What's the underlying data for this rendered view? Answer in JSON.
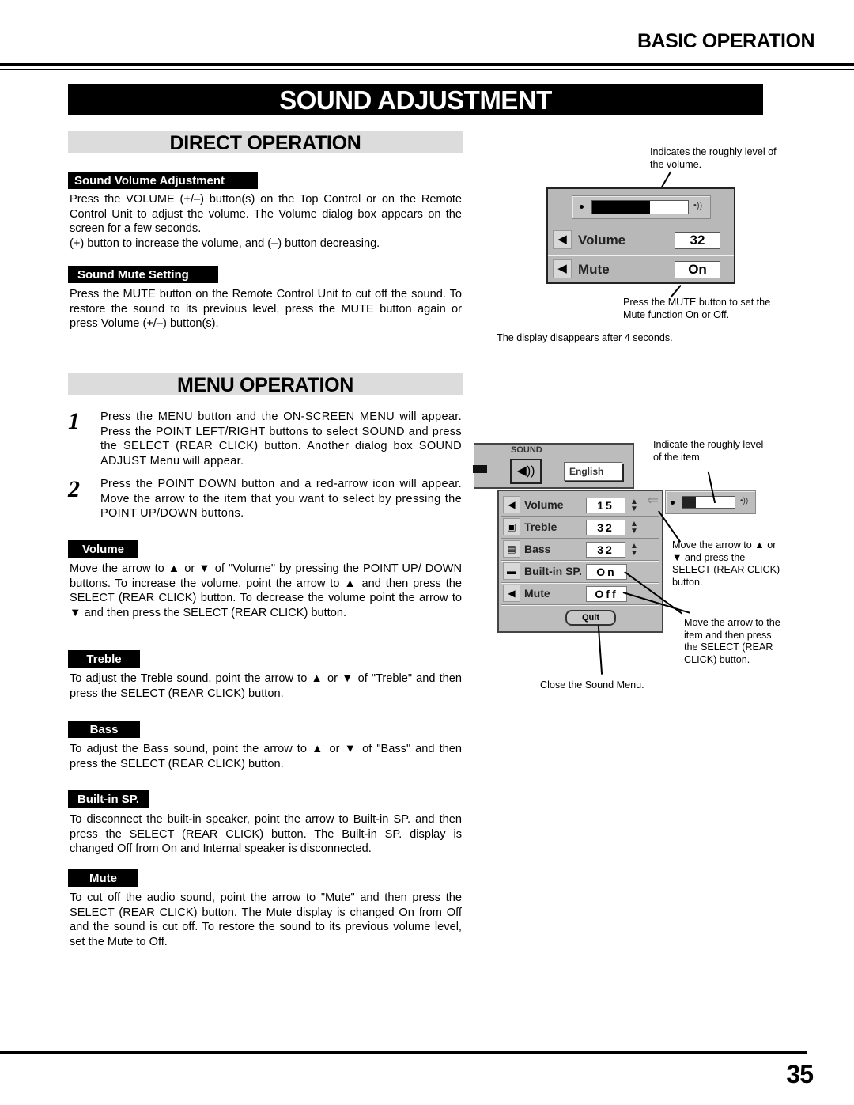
{
  "header": {
    "section_title": "BASIC OPERATION"
  },
  "main_title": "SOUND ADJUSTMENT",
  "direct_operation": {
    "heading": "DIRECT OPERATION",
    "volume_adjustment": {
      "label": "Sound Volume Adjustment",
      "text_1": "Press the VOLUME (+/–) button(s) on the Top Control or on the Remote Control Unit to adjust the volume.  The Volume dialog box appears on the screen for a few seconds.",
      "text_2": "(+) button to increase the volume, and (–) button  decreasing."
    },
    "mute_setting": {
      "label": "Sound Mute Setting",
      "text": "Press the MUTE button on the Remote Control Unit to cut off the sound.  To restore the sound to its previous level, press the MUTE button again or press Volume (+/–) button(s)."
    },
    "figure": {
      "note_top": "Indicates the roughly level of the volume.",
      "note_bottom": "Press the MUTE button to set the Mute function On or Off.",
      "note_footer": "The display disappears after 4 seconds.",
      "dialog": {
        "volume_level_fraction": 0.6,
        "volume_label": "Volume",
        "volume_value": "32",
        "mute_label": "Mute",
        "mute_value": "On",
        "icons": {
          "speaker": "speaker-icon",
          "mute": "speaker-mute-icon"
        }
      }
    }
  },
  "menu_operation": {
    "heading": "MENU OPERATION",
    "steps": [
      {
        "number": "1",
        "text": "Press the MENU button and the ON-SCREEN MENU will appear.  Press the POINT LEFT/RIGHT buttons to select SOUND and press the SELECT (REAR CLICK) button.  Another dialog box SOUND ADJUST Menu will appear."
      },
      {
        "number": "2",
        "text": "Press the POINT DOWN button and a red-arrow icon will appear.  Move the arrow to the item that you want to select by pressing the POINT UP/DOWN buttons."
      }
    ],
    "items": [
      {
        "label": "Volume",
        "text": "Move the arrow to ▲ or ▼ of \"Volume\" by pressing the POINT UP/ DOWN buttons.  To increase the volume, point the arrow to ▲ and then press the SELECT (REAR CLICK) button.  To decrease the volume point the arrow to ▼ and then press the SELECT (REAR CLICK) button."
      },
      {
        "label": "Treble",
        "text": "To adjust the Treble sound, point the arrow to ▲ or ▼ of \"Treble\" and then press the SELECT (REAR CLICK) button."
      },
      {
        "label": "Bass",
        "text": "To adjust the Bass sound, point the arrow to ▲ or ▼ of \"Bass\" and then press the SELECT (REAR CLICK) button."
      },
      {
        "label": "Built-in SP.",
        "text": "To disconnect the built-in speaker, point the arrow to Built-in SP. and then press the SELECT (REAR CLICK) button. The Built-in SP. display is changed Off from On and Internal speaker is disconnected."
      },
      {
        "label": "Mute",
        "text": "To cut off the audio sound, point the arrow to \"Mute\" and then press the SELECT (REAR CLICK) button.  The Mute display is changed On from Off and the sound is cut off.  To restore the sound to its previous volume level, set the Mute to Off."
      }
    ],
    "figure": {
      "top_menu": {
        "title": "SOUND",
        "language": "English"
      },
      "menu_rows": [
        {
          "label": "Volume",
          "value": "15",
          "adjustable": true,
          "icon": "speaker-icon"
        },
        {
          "label": "Treble",
          "value": "32",
          "adjustable": true,
          "icon": "treble-icon"
        },
        {
          "label": "Bass",
          "value": "32",
          "adjustable": true,
          "icon": "bass-icon"
        },
        {
          "label": "Built-in SP.",
          "value": "On",
          "adjustable": false,
          "icon": "builtin-speaker-icon"
        },
        {
          "label": "Mute",
          "value": "Off",
          "adjustable": false,
          "icon": "speaker-mute-icon"
        }
      ],
      "quit_label": "Quit",
      "level_fraction": 0.25,
      "note_level": "Indicate the roughly level of the item.",
      "note_arrow": "Move the arrow to ▲ or ▼ and press the SELECT (REAR CLICK) button.",
      "note_select": "Move the arrow to the item and then press the SELECT (REAR CLICK) button.",
      "note_quit": "Close the Sound Menu."
    }
  },
  "footer": {
    "page_number": "35"
  }
}
